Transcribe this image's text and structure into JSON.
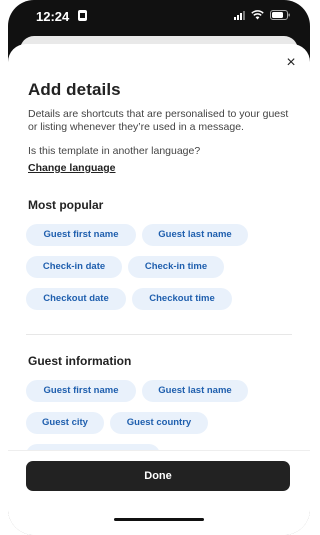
{
  "status_bar": {
    "time": "12:24",
    "icons": [
      "sim-card-icon",
      "signal-icon",
      "wifi-icon",
      "battery-icon"
    ]
  },
  "sheet": {
    "close_glyph": "×",
    "title": "Add details",
    "description": "Details are shortcuts that are personalised to your guest or listing whenever they’re used in a message.",
    "language_question": "Is this template in another language?",
    "change_language_link": "Change language",
    "sections": [
      {
        "title": "Most popular",
        "chips": [
          "Guest first name",
          "Guest last name",
          "Check-in date",
          "Check-in time",
          "Checkout date",
          "Checkout time"
        ]
      },
      {
        "title": "Guest information",
        "chips": [
          "Guest first name",
          "Guest last name",
          "Guest city",
          "Guest country",
          "Guest phone number"
        ]
      }
    ],
    "done_label": "Done"
  },
  "colors": {
    "chip_bg": "#e9f1fb",
    "chip_text": "#1f5fae",
    "button_bg": "#222222",
    "phone_frame": "#111111"
  }
}
